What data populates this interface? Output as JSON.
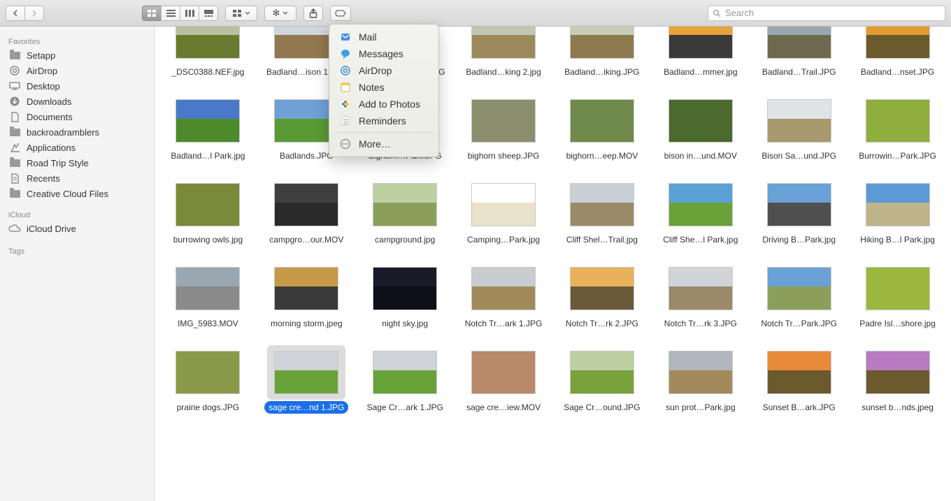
{
  "search": {
    "placeholder": "Search"
  },
  "share_menu": {
    "items": [
      "Mail",
      "Messages",
      "AirDrop",
      "Notes",
      "Add to Photos",
      "Reminders"
    ],
    "more": "More…"
  },
  "sidebar": {
    "favorites_heading": "Favorites",
    "favorites": [
      {
        "label": "Setapp",
        "icon": "folder"
      },
      {
        "label": "AirDrop",
        "icon": "airdrop"
      },
      {
        "label": "Desktop",
        "icon": "desktop"
      },
      {
        "label": "Downloads",
        "icon": "downloads"
      },
      {
        "label": "Documents",
        "icon": "documents"
      },
      {
        "label": "backroadramblers",
        "icon": "folder"
      },
      {
        "label": "Applications",
        "icon": "applications"
      },
      {
        "label": "Road Trip Style",
        "icon": "folder"
      },
      {
        "label": "Recents",
        "icon": "recents"
      },
      {
        "label": "Creative Cloud Files",
        "icon": "folder"
      }
    ],
    "icloud_heading": "iCloud",
    "icloud": [
      {
        "label": "iCloud Drive",
        "icon": "cloud"
      }
    ],
    "tags_heading": "Tags"
  },
  "files": [
    {
      "name": "_DSC0388.NEF.jpg",
      "sky": "#b9c0a0",
      "ground": "#6a7a2f"
    },
    {
      "name": "Badland…ison 1.JPG",
      "sky": "#cfd6dd",
      "ground": "#91784f"
    },
    {
      "name": "Badland…ison 2.JPG",
      "sky": "#a9b3bb",
      "ground": "#7a6a48"
    },
    {
      "name": "Badland…king 2.jpg",
      "sky": "#bfc6b4",
      "ground": "#9d8a5c"
    },
    {
      "name": "Badland…iking.JPG",
      "sky": "#c8cbb9",
      "ground": "#8d7a4f"
    },
    {
      "name": "Badland…mmer.jpg",
      "sky": "#e8a23a",
      "ground": "#3a3a3a"
    },
    {
      "name": "Badland…Trail.JPG",
      "sky": "#9aa7b0",
      "ground": "#6f6a4f"
    },
    {
      "name": "Badland…nset.JPG",
      "sky": "#e39a2e",
      "ground": "#6a5a2e"
    },
    {
      "name": "Badland…l Park.jpg",
      "sky": "#4b79c9",
      "ground": "#4c8a2a"
    },
    {
      "name": "Badlands.JPG",
      "sky": "#6fa0d6",
      "ground": "#5a9a34"
    },
    {
      "name": "Bighorn…Park.JPG",
      "sky": "#c7ccd1",
      "ground": "#82885a"
    },
    {
      "name": "bighorn sheep.JPG",
      "sky": "#8b8f6f",
      "ground": "#8b8f6f"
    },
    {
      "name": "bighorn…eep.MOV",
      "sky": "#6f8a4a",
      "ground": "#6f8a4a"
    },
    {
      "name": "bison in…und.MOV",
      "sky": "#4a6a2e",
      "ground": "#4a6a2e"
    },
    {
      "name": "Bison Sa…und.JPG",
      "sky": "#dfe3e6",
      "ground": "#a79a6f"
    },
    {
      "name": "Burrowin…Park.JPG",
      "sky": "#8fae3d",
      "ground": "#8fae3d"
    },
    {
      "name": "burrowing owls.jpg",
      "sky": "#7a8a3a",
      "ground": "#7a8a3a"
    },
    {
      "name": "campgro…our.MOV",
      "sky": "#3f3f3f",
      "ground": "#2a2a2a"
    },
    {
      "name": "campground.jpg",
      "sky": "#bcd0a2",
      "ground": "#8aa05a"
    },
    {
      "name": "Camping…Park.jpg",
      "sky": "#ffffff",
      "ground": "#e9e2c8"
    },
    {
      "name": "Cliff Shel…Trail.jpg",
      "sky": "#c9cfd3",
      "ground": "#9a8a6a"
    },
    {
      "name": "Cliff She…l Park.jpg",
      "sky": "#5aa1d6",
      "ground": "#6aa23a"
    },
    {
      "name": "Driving B…Park.jpg",
      "sky": "#6aa1d6",
      "ground": "#4f4f4f"
    },
    {
      "name": "Hiking B…l Park.jpg",
      "sky": "#5c9ad6",
      "ground": "#bdb48a"
    },
    {
      "name": "IMG_5983.MOV",
      "sky": "#9aa7b0",
      "ground": "#8a8a8a"
    },
    {
      "name": "morning storm.jpeg",
      "sky": "#c79a4a",
      "ground": "#3a3a3a"
    },
    {
      "name": "night sky.jpg",
      "sky": "#1a1a2a",
      "ground": "#0f0f18"
    },
    {
      "name": "Notch Tr…ark 1.JPG",
      "sky": "#c7ccd1",
      "ground": "#a28a5a"
    },
    {
      "name": "Notch Tr…rk 2.JPG",
      "sky": "#e8b15a",
      "ground": "#6a5a3a"
    },
    {
      "name": "Notch Tr…rk 3.JPG",
      "sky": "#d0d4d8",
      "ground": "#9a8a6a"
    },
    {
      "name": "Notch Tr…Park.JPG",
      "sky": "#6aa1d6",
      "ground": "#8aa05a"
    },
    {
      "name": "Padre Isl…shore.jpg",
      "sky": "#9ab83d",
      "ground": "#9ab83d"
    },
    {
      "name": "prairie dogs.JPG",
      "sky": "#8a9a4a",
      "ground": "#8a9a4a"
    },
    {
      "name": "sage cre…nd 1.JPG",
      "sky": "#d0d4d8",
      "ground": "#6aa23a",
      "selected": true
    },
    {
      "name": "Sage Cr…ark 1.JPG",
      "sky": "#d0d4d8",
      "ground": "#6aa23a"
    },
    {
      "name": "sage cre…iew.MOV",
      "sky": "#b88a6a",
      "ground": "#b88a6a"
    },
    {
      "name": "Sage Cr…ound.JPG",
      "sky": "#bcd0a2",
      "ground": "#7aa23a"
    },
    {
      "name": "sun prot…Park.jpg",
      "sky": "#b0b6bb",
      "ground": "#a28a5a"
    },
    {
      "name": "Sunset B…ark.JPG",
      "sky": "#e88a3a",
      "ground": "#6a5a2e"
    },
    {
      "name": "sunset b…nds.jpeg",
      "sky": "#b87ac0",
      "ground": "#6a5a2e"
    }
  ]
}
